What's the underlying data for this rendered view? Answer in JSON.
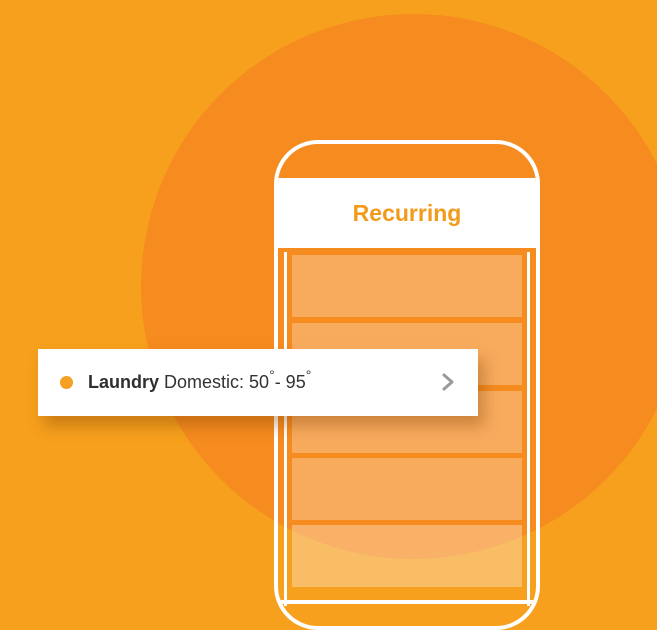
{
  "colors": {
    "background": "#f7a01d",
    "circle": "#f68b1f",
    "accent": "#f29a1a",
    "card": "#ffffff"
  },
  "phone": {
    "title": "Recurring",
    "rows": 5
  },
  "card": {
    "bullet_icon": "dot-icon",
    "name": "Laundry",
    "description": "Domestic: 50",
    "degree_symbol": "°",
    "separator": "- 95",
    "chevron_icon": "chevron-right-icon"
  }
}
